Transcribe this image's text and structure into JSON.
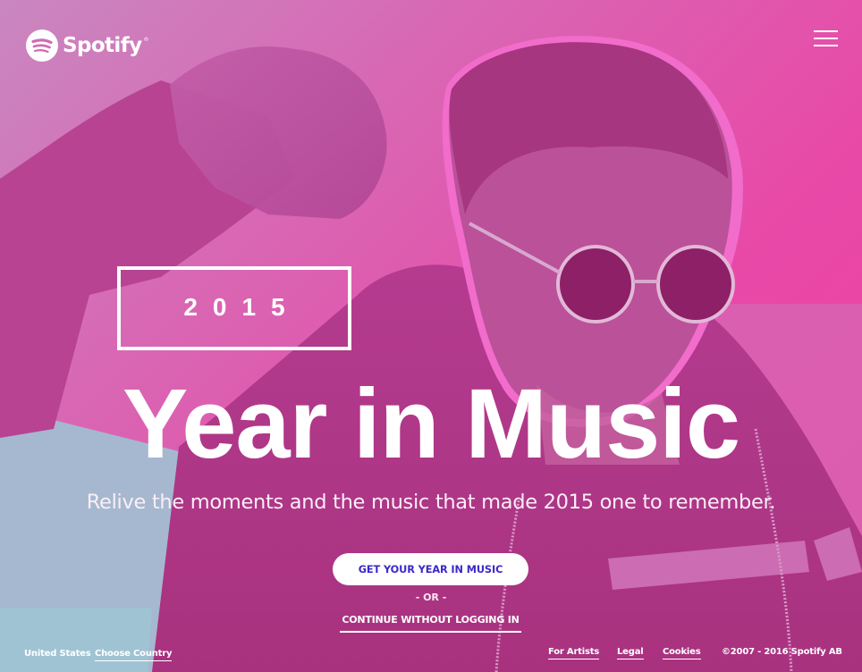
{
  "header": {
    "logo_text": "Spotify",
    "logo_icon": "spotify-logo-icon",
    "menu_icon": "hamburger-menu-icon"
  },
  "hero": {
    "year": "2015",
    "title": "Year in Music",
    "subtitle": "Relive the moments and the music that made 2015 one to remember.",
    "cta_label": "GET YOUR YEAR IN MUSIC",
    "or_label": "- OR -",
    "continue_label": "CONTINUE WITHOUT LOGGING IN"
  },
  "footer": {
    "country": "United States",
    "choose_country": "Choose Country",
    "links": [
      "For Artists",
      "Legal",
      "Cookies"
    ],
    "copyright": "©2007 - 2016 Spotify AB"
  },
  "colors": {
    "background_pink": "#e849a7",
    "background_mauve": "#c987c0",
    "cta_text": "#3a29c8",
    "accent_blue_grey": "#9fc3d3",
    "text": "#ffffff"
  }
}
